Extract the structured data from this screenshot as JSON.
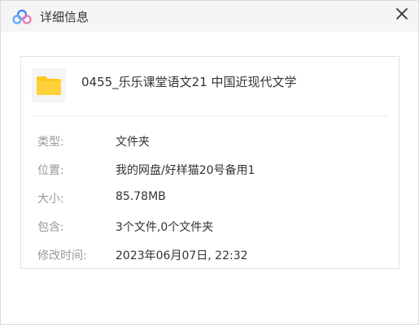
{
  "window": {
    "title": "详细信息",
    "app_icon": "cloud-logo-icon",
    "close_icon": "close-icon"
  },
  "file": {
    "icon": "folder-icon",
    "name": "0455_乐乐课堂语文21 中国近现代文学"
  },
  "details": {
    "type": {
      "label": "类型:",
      "value": "文件夹"
    },
    "location": {
      "label": "位置:",
      "value": "我的网盘/好样猫20号备用1"
    },
    "size": {
      "label": "大小:",
      "value": "85.78MB"
    },
    "contains": {
      "label": "包含:",
      "value": "3个文件,0个文件夹"
    },
    "modified": {
      "label": "修改时间:",
      "value": "2023年06月07日, 22:32"
    }
  },
  "colors": {
    "titlebar_bg": "#f5f5f5",
    "folder_yellow": "#ffc81e",
    "label_gray": "#999999",
    "text_dark": "#333333",
    "logo_blue": "#3b82f6",
    "logo_pink": "#f472b6"
  }
}
